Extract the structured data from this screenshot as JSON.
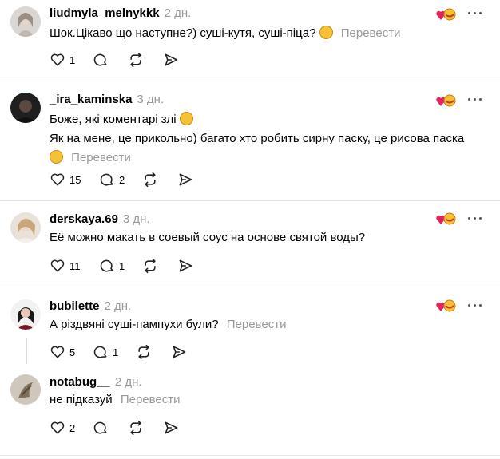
{
  "comments": [
    {
      "username": "liudmyla_melnykkk",
      "time": "2 дн.",
      "lines": [
        "Шок.Цікаво що наступне?) суші-кутя, суші-піца?"
      ],
      "translate": "Перевести",
      "likes": "1",
      "replies": ""
    },
    {
      "username": "_ira_kaminska",
      "time": "3 дн.",
      "lines": [
        "Боже, які коментарі злі",
        "Як на мене, це прикольно) багато хто робить сирну паску, це рисова паска"
      ],
      "translate": "Перевести",
      "likes": "15",
      "replies": "2"
    },
    {
      "username": "derskaya.69",
      "time": "3 дн.",
      "lines": [
        "Её можно макать в соевый соус на основе святой воды?"
      ],
      "translate": "",
      "likes": "11",
      "replies": "1"
    },
    {
      "username": "bubilette",
      "time": "2 дн.",
      "lines": [
        "А різдвяні суші-пампухи були?"
      ],
      "translate": "Перевести",
      "likes": "5",
      "replies": "1"
    },
    {
      "username": "notabug__",
      "time": "2 дн.",
      "lines": [
        "не підказуй"
      ],
      "translate": "Перевести",
      "likes": "2",
      "replies": ""
    }
  ],
  "colors": {
    "muted": "#999999",
    "divider": "#e5e5e5",
    "reaction": "#e0245e"
  },
  "icons": [
    "heart-icon",
    "comment-icon",
    "repost-icon",
    "share-icon",
    "more-icon",
    "reaction-icon"
  ]
}
